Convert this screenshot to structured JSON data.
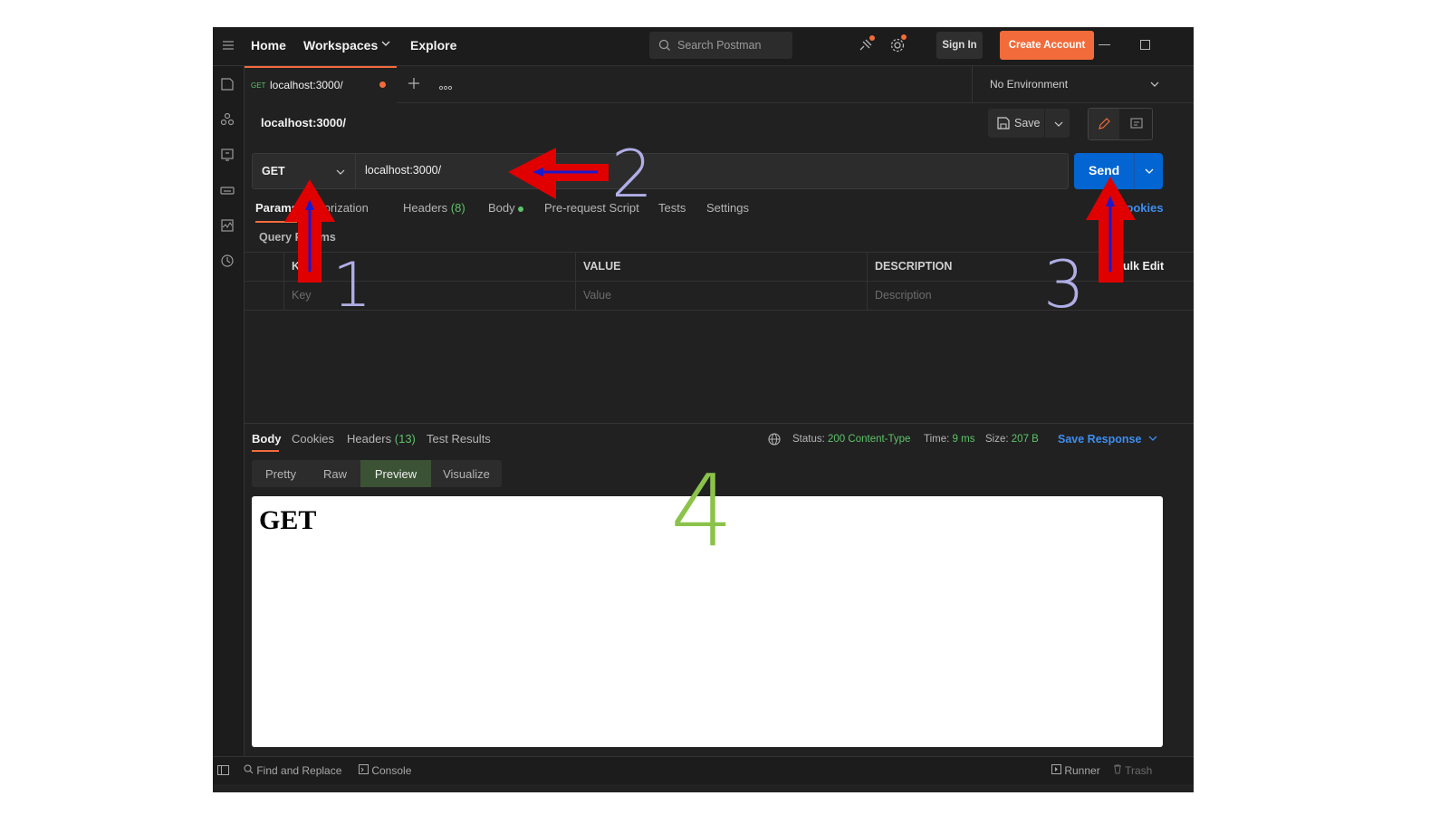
{
  "topbar": {
    "nav": [
      "Home",
      "Workspaces",
      "Explore"
    ],
    "search_placeholder": "Search Postman",
    "sign_in": "Sign In",
    "create_account": "Create Account"
  },
  "tab": {
    "method": "GET",
    "title": "localhost:3000/"
  },
  "environment": "No Environment",
  "request": {
    "name": "localhost:3000/",
    "save_label": "Save",
    "method": "GET",
    "url": "localhost:3000/",
    "send_label": "Send"
  },
  "request_tabs": {
    "params": "Params",
    "authorization": "Authorization",
    "headers": "Headers",
    "headers_count": "(8)",
    "body": "Body",
    "prerequest": "Pre-request Script",
    "tests": "Tests",
    "settings": "Settings",
    "cookies": "Cookies"
  },
  "params": {
    "section_title": "Query Params",
    "columns": [
      "KEY",
      "VALUE",
      "DESCRIPTION"
    ],
    "bulk_edit": "Bulk Edit",
    "placeholders": [
      "Key",
      "Value",
      "Description"
    ]
  },
  "response": {
    "tabs": [
      "Body",
      "Cookies",
      "Headers",
      "Test Results"
    ],
    "headers_count": "(13)",
    "status_label": "Status:",
    "status_value": "200 Content-Type",
    "time_label": "Time:",
    "time_value": "9 ms",
    "size_label": "Size:",
    "size_value": "207 B",
    "save_response": "Save Response",
    "view_modes": [
      "Pretty",
      "Raw",
      "Preview",
      "Visualize"
    ],
    "selected_mode": "Preview",
    "preview_text": "GET"
  },
  "footer": {
    "find_replace": "Find and Replace",
    "console": "Console",
    "runner": "Runner",
    "trash": "Trash"
  },
  "annotations": {
    "labels": [
      "1",
      "2",
      "3",
      "4"
    ],
    "arrow_color": "#e00000",
    "arrow_inner_color": "#1a1acc",
    "number_color": "#b0aee6",
    "number4_color": "#8bc34a"
  },
  "colors": {
    "accent_orange": "#f26b3a",
    "send_blue": "#0265d2",
    "status_green": "#5ec26a",
    "link_blue": "#3d8ef0"
  }
}
